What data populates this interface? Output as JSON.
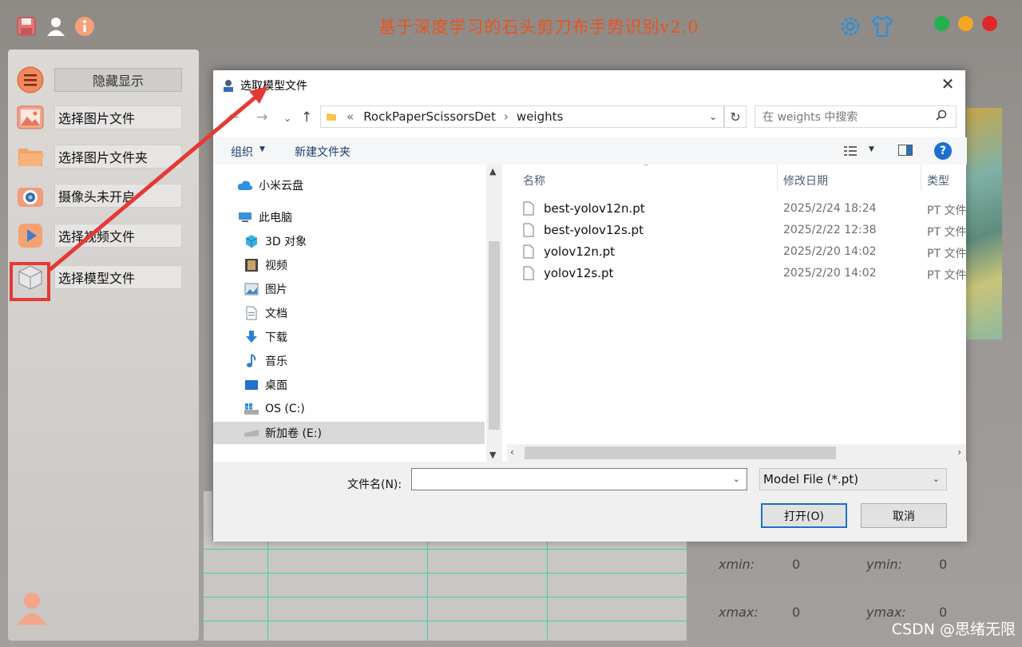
{
  "app": {
    "title": "基于深度学习的石头剪刀布手势识别v2.0",
    "icons": [
      "save-icon",
      "user-icon",
      "info-icon",
      "gear-icon",
      "shirt-icon"
    ],
    "colors": {
      "title": "#e8541e",
      "green": "#22b14c",
      "orange": "#f5a623",
      "red": "#e3262a",
      "highlight": "#e53935"
    }
  },
  "sidebar": {
    "items": [
      {
        "label": "隐藏显示",
        "icon": "menu-icon"
      },
      {
        "label": "选择图片文件",
        "icon": "image-icon"
      },
      {
        "label": "选择图片文件夹",
        "icon": "folder-icon"
      },
      {
        "label": "摄像头未开启",
        "icon": "camera-icon"
      },
      {
        "label": "选择视频文件",
        "icon": "play-icon"
      },
      {
        "label": "选择模型文件",
        "icon": "cube-icon"
      }
    ]
  },
  "coords": {
    "xmin_label": "xmin:",
    "xmin": "0",
    "ymin_label": "ymin:",
    "ymin": "0",
    "xmax_label": "xmax:",
    "xmax": "0",
    "ymax_label": "ymax:",
    "ymax": "0"
  },
  "watermark": "CSDN @思绪无限",
  "dialog": {
    "title": "选取模型文件",
    "breadcrumb": [
      "«",
      "RockPaperScissorsDet",
      "weights"
    ],
    "search_placeholder": "在 weights 中搜索",
    "toolbar": {
      "organize": "组织",
      "new_folder": "新建文件夹"
    },
    "tree": [
      {
        "label": "小米云盘",
        "icon": "cloud-icon"
      },
      {
        "label": "此电脑",
        "icon": "computer-icon"
      },
      {
        "label": "3D 对象",
        "icon": "cube3d-icon"
      },
      {
        "label": "视频",
        "icon": "video-icon"
      },
      {
        "label": "图片",
        "icon": "picture-icon"
      },
      {
        "label": "文档",
        "icon": "document-icon"
      },
      {
        "label": "下载",
        "icon": "download-icon"
      },
      {
        "label": "音乐",
        "icon": "music-icon"
      },
      {
        "label": "桌面",
        "icon": "desktop-icon"
      },
      {
        "label": "OS (C:)",
        "icon": "drive-c-icon"
      },
      {
        "label": "新加卷 (E:)",
        "icon": "drive-e-icon",
        "selected": true
      }
    ],
    "columns": {
      "name": "名称",
      "date": "修改日期",
      "type": "类型"
    },
    "files": [
      {
        "name": "best-yolov12n.pt",
        "date": "2025/2/24 18:24",
        "type": "PT 文件"
      },
      {
        "name": "best-yolov12s.pt",
        "date": "2025/2/22 12:38",
        "type": "PT 文件"
      },
      {
        "name": "yolov12n.pt",
        "date": "2025/2/20 14:02",
        "type": "PT 文件"
      },
      {
        "name": "yolov12s.pt",
        "date": "2025/2/20 14:02",
        "type": "PT 文件"
      }
    ],
    "filename_label": "文件名(N):",
    "filename_value": "",
    "filter": "Model File (*.pt)",
    "open_label": "打开(O)",
    "cancel_label": "取消"
  }
}
